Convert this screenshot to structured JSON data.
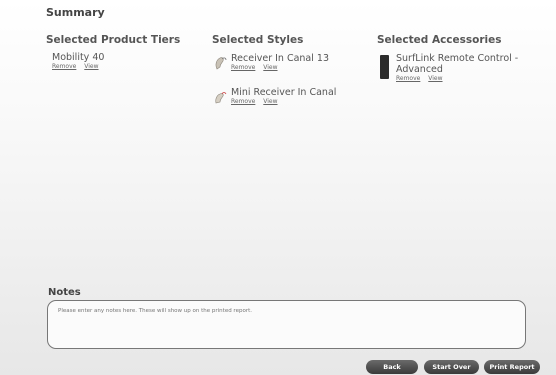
{
  "page": {
    "title": "Summary"
  },
  "columns": {
    "tiers": {
      "heading": "Selected Product Tiers",
      "items": [
        {
          "name": "Mobility 40",
          "remove": "Remove",
          "view": "View"
        }
      ]
    },
    "styles": {
      "heading": "Selected Styles",
      "items": [
        {
          "name": "Receiver In Canal 13",
          "remove": "Remove",
          "view": "View",
          "icon": "hearing-aid-ric-icon"
        },
        {
          "name": "Mini Receiver In Canal",
          "remove": "Remove",
          "view": "View",
          "icon": "hearing-aid-mini-ric-icon"
        }
      ]
    },
    "accessories": {
      "heading": "Selected Accessories",
      "items": [
        {
          "name": "SurfLink Remote Control - Advanced",
          "remove": "Remove",
          "view": "View",
          "icon": "remote-control-icon"
        }
      ]
    }
  },
  "notes": {
    "title": "Notes",
    "placeholder": "Please enter any notes here. These will show up on the printed report.",
    "value": ""
  },
  "buttons": {
    "back": "Back",
    "start_over": "Start Over",
    "print_report": "Print Report"
  }
}
